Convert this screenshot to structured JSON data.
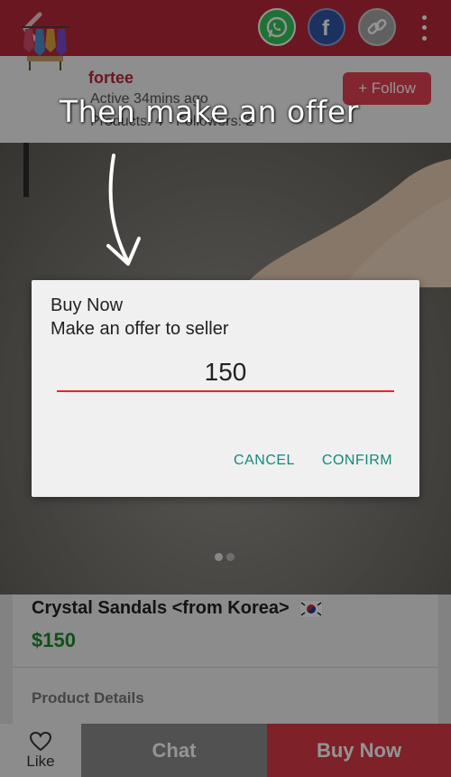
{
  "seller": {
    "name": "fortee",
    "active": "Active 34mins ago",
    "products": "Products: 4 · Followers: 2",
    "follow_label": "+ Follow"
  },
  "product": {
    "title": "Crystal Sandals <from Korea>",
    "flag_icon": "south-korea-flag-icon",
    "price": "$150",
    "details_label": "Product Details"
  },
  "bottom": {
    "like_label": "Like",
    "chat_label": "Chat",
    "buy_label": "Buy Now"
  },
  "annotation": {
    "text": "Then make an offer"
  },
  "dialog": {
    "title": "Buy Now",
    "message": "Make an offer to seller",
    "offer_value": "150",
    "cancel_label": "CANCEL",
    "confirm_label": "CONFIRM"
  },
  "icons": {
    "back": "chevron-left-icon",
    "share": [
      "whatsapp-icon",
      "facebook-icon",
      "link-icon"
    ],
    "more": "more-vertical-icon",
    "like": "heart-icon"
  },
  "colors": {
    "brand": "#b9283a",
    "price": "#1d8b2c",
    "accent_button": "#13897a",
    "input_underline": "#e5262e"
  }
}
